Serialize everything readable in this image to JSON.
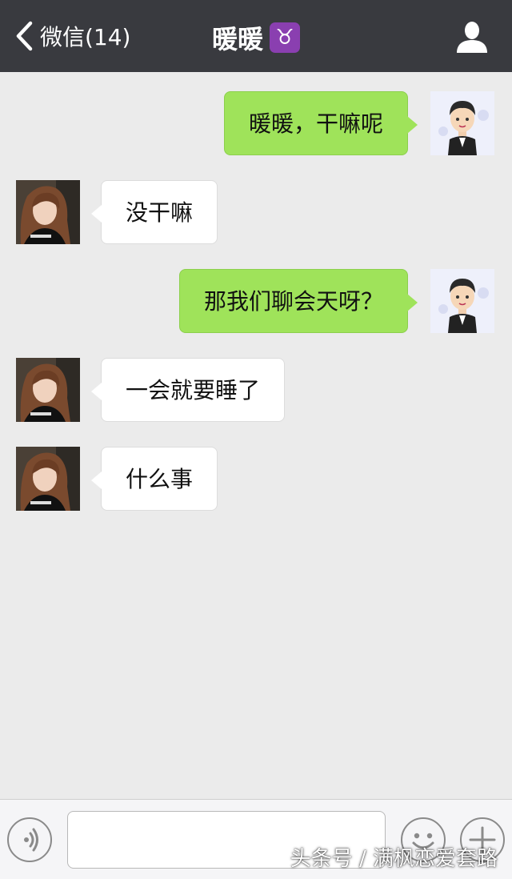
{
  "header": {
    "back_label": "微信(14)",
    "title": "暖暖",
    "zodiac_symbol": "♉",
    "bg_color": "#393a3f"
  },
  "messages": [
    {
      "side": "out",
      "text": "暖暖，干嘛呢"
    },
    {
      "side": "in",
      "text": "没干嘛"
    },
    {
      "side": "out",
      "text": "那我们聊会天呀？"
    },
    {
      "side": "in",
      "text": "一会就要睡了"
    },
    {
      "side": "in",
      "text": "什么事"
    }
  ],
  "colors": {
    "outgoing_bubble": "#9fe35a",
    "incoming_bubble": "#ffffff",
    "chat_background": "#ebebeb"
  },
  "input_bar": {
    "input_value": "",
    "icons": [
      "voice-icon",
      "emoji-icon",
      "plus-icon"
    ]
  },
  "watermark": "头条号 / 满枫恋爱套路"
}
